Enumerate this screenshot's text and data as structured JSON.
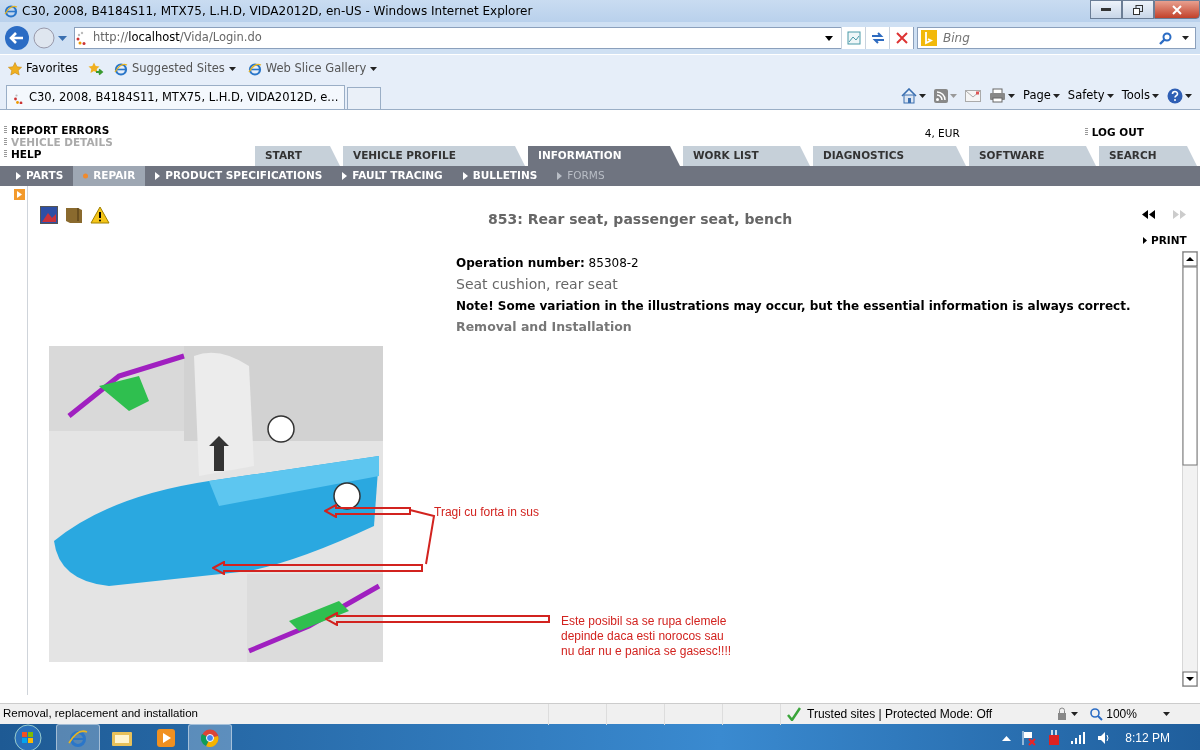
{
  "window": {
    "title": "C30, 2008, B4184S11, MTX75, L.H.D, VIDA2012D, en-US - Windows Internet Explorer"
  },
  "address_bar": {
    "url": "http://**localhost**/Vida/Login.do"
  },
  "search_box": {
    "placeholder": "Bing"
  },
  "favorites_bar": [
    {
      "kind": "favorites",
      "label": "Favorites"
    },
    {
      "kind": "site",
      "label": "Suggested Sites"
    },
    {
      "kind": "site",
      "label": "Web Slice Gallery"
    }
  ],
  "browser_tabs": [
    {
      "label": "C30, 2008, B4184S11, MTX75, L.H.D, VIDA2012D, e...",
      "selected": true
    }
  ],
  "command_bar": [
    "Page",
    "Safety",
    "Tools"
  ],
  "header_links": [
    {
      "label": "REPORT ERRORS",
      "disabled": false
    },
    {
      "label": "VEHICLE DETAILS",
      "disabled": true
    },
    {
      "label": "HELP",
      "disabled": false
    }
  ],
  "user_info": "4, EUR",
  "logout": "LOG OUT",
  "main_tabs": [
    {
      "label": "START",
      "selected": false
    },
    {
      "label": "VEHICLE PROFILE",
      "selected": false
    },
    {
      "label": "INFORMATION",
      "selected": true
    },
    {
      "label": "WORK LIST",
      "selected": false
    },
    {
      "label": "DIAGNOSTICS",
      "selected": false
    },
    {
      "label": "SOFTWARE",
      "selected": false
    },
    {
      "label": "SEARCH",
      "selected": false
    }
  ],
  "sub_nav": [
    {
      "label": "PARTS",
      "selected": false,
      "disabled": false
    },
    {
      "label": "REPAIR",
      "selected": true,
      "disabled": false
    },
    {
      "label": "PRODUCT SPECIFICATIONS",
      "selected": false,
      "disabled": false
    },
    {
      "label": "FAULT TRACING",
      "selected": false,
      "disabled": false
    },
    {
      "label": "BULLETINS",
      "selected": false,
      "disabled": false
    },
    {
      "label": "FORMS",
      "selected": false,
      "disabled": true
    }
  ],
  "document": {
    "title": "853: Rear seat, passenger seat, bench",
    "print": "PRINT",
    "operation": "**Operation number:** 85308-2",
    "subtitle": "Seat cushion, rear seat",
    "note": "Note! Some variation in the illustrations may occur, but the essential information is always correct.",
    "section": "Removal and Installation"
  },
  "annotations": [
    {
      "lines": [
        "Tragi cu forta in sus"
      ]
    },
    {
      "lines": [
        "Este posibil sa se rupa clemele",
        "depinde daca esti norocos sau",
        "nu dar nu e panica se gasesc!!!!"
      ]
    }
  ],
  "status_bar": {
    "text": "Removal, replacement and installation",
    "zone": "Trusted sites | Protected Mode: Off",
    "zoom": "100%"
  },
  "taskbar": {
    "clock": "8:12 PM"
  }
}
